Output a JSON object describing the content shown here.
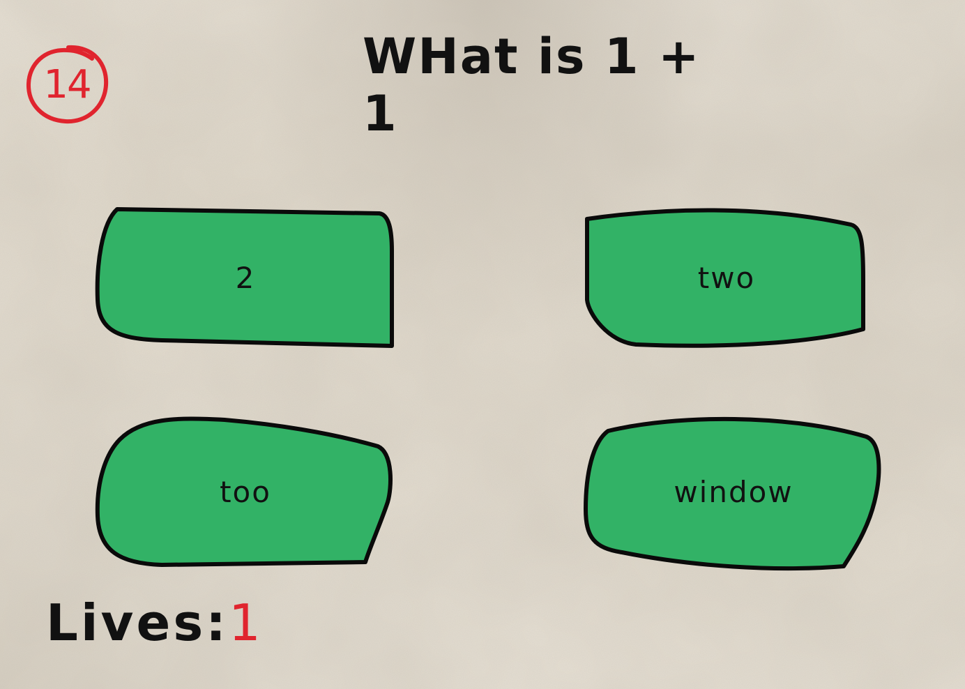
{
  "game": {
    "level": "14",
    "question": "WHat is 1 + 1",
    "lives_label": "Lives:",
    "lives_count": "1"
  },
  "answers": [
    {
      "label": "2"
    },
    {
      "label": "two"
    },
    {
      "label": "too"
    },
    {
      "label": "window"
    }
  ],
  "colors": {
    "paper": "#ebe5da",
    "button_fill": "#32b266",
    "button_outline": "#0a0a0a",
    "accent_red": "#e0242e",
    "text": "#111111"
  }
}
